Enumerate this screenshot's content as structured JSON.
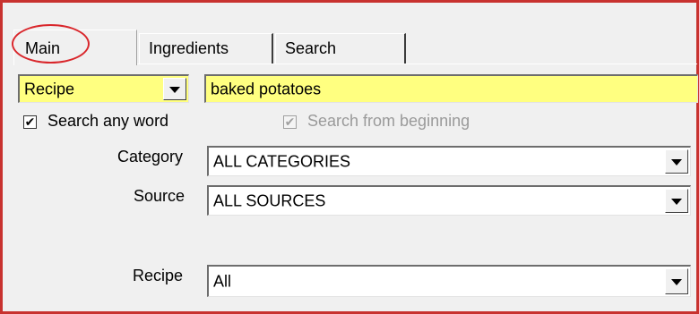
{
  "tabs": {
    "main": "Main",
    "ingredients": "Ingredients",
    "search": "Search"
  },
  "search_type": {
    "value": "Recipe"
  },
  "search_term": {
    "value": "baked potatoes"
  },
  "options": {
    "any_word": {
      "label": "Search any word",
      "checked": true,
      "check_glyph": "✔"
    },
    "from_beginning": {
      "label": "Search from beginning",
      "checked": true,
      "enabled": false,
      "check_glyph": "✔"
    }
  },
  "filters": {
    "category": {
      "label": "Category",
      "value": "ALL CATEGORIES"
    },
    "source": {
      "label": "Source",
      "value": "ALL SOURCES"
    },
    "recipe": {
      "label": "Recipe",
      "value": "All"
    }
  },
  "colors": {
    "highlight_field": "#ffff80",
    "annotation_red": "#d9262b",
    "frame_red": "#c8322f"
  }
}
